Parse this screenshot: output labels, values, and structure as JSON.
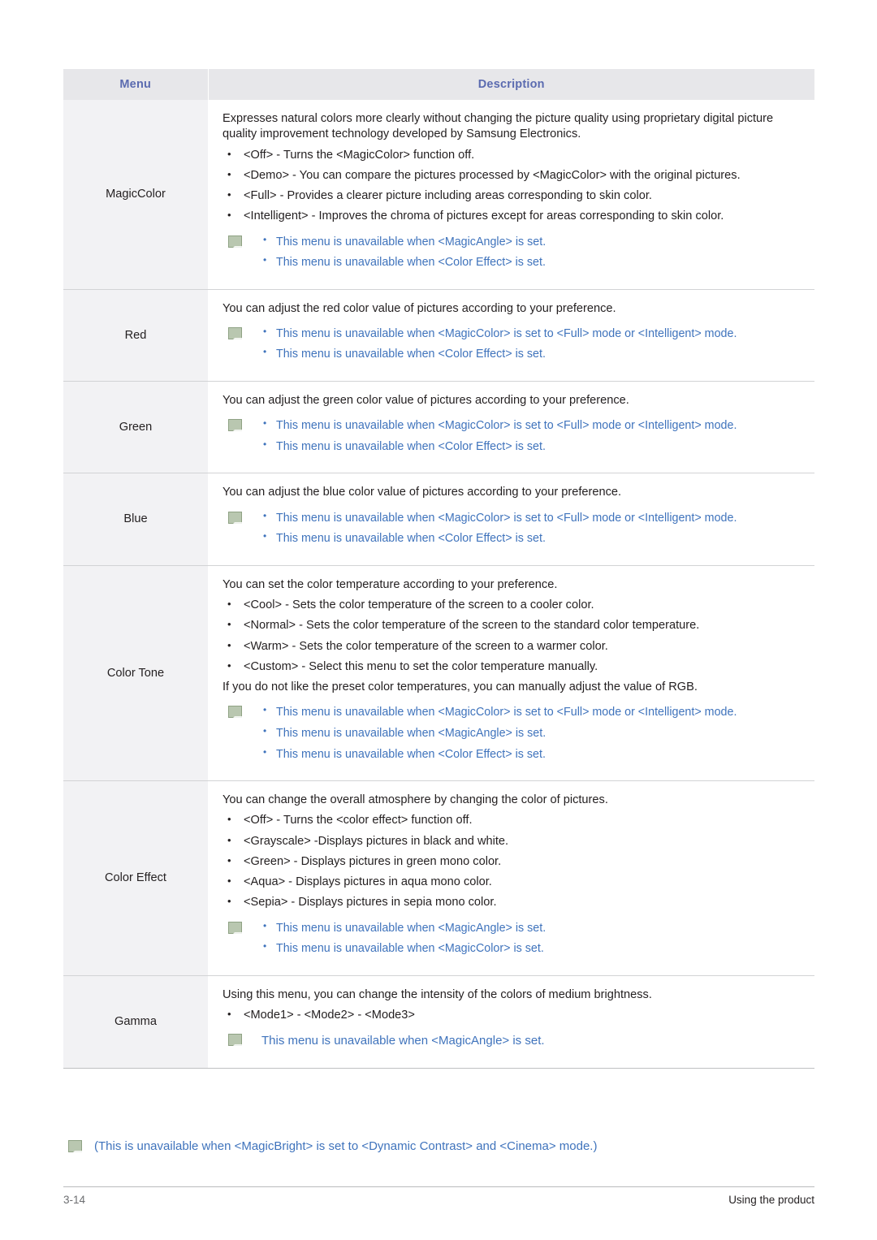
{
  "table": {
    "headers": {
      "menu": "Menu",
      "description": "Description"
    },
    "rows": [
      {
        "menu": "MagicColor",
        "intro": [
          "Expresses natural colors more clearly without changing the picture quality using proprietary digital picture quality improvement technology developed by Samsung Electronics."
        ],
        "bullets": [
          "<Off> - Turns the <MagicColor> function off.",
          "<Demo> - You can compare the pictures processed by <MagicColor> with the original pictures.",
          "<Full> - Provides a clearer picture including areas corresponding to skin color.",
          "<Intelligent> - Improves the chroma of pictures except for areas corresponding to skin color."
        ],
        "notes": [
          "This menu is unavailable when <MagicAngle> is set.",
          "This menu is unavailable when <Color Effect> is set."
        ],
        "note_style": "list"
      },
      {
        "menu": "Red",
        "intro": [
          "You can adjust the red color value of pictures according to your preference."
        ],
        "bullets": [],
        "notes": [
          "This menu is unavailable when <MagicColor> is set to <Full> mode or <Intelligent> mode.",
          "This menu is unavailable when <Color Effect> is set."
        ],
        "note_style": "list"
      },
      {
        "menu": "Green",
        "intro": [
          "You can adjust the green color value of pictures according to your preference."
        ],
        "bullets": [],
        "notes": [
          "This menu is unavailable when <MagicColor> is set to <Full> mode or <Intelligent> mode.",
          "This menu is unavailable when <Color Effect> is set."
        ],
        "note_style": "list"
      },
      {
        "menu": "Blue",
        "intro": [
          "You can adjust the blue color value of pictures according to your preference."
        ],
        "bullets": [],
        "notes": [
          "This menu is unavailable when <MagicColor> is set to <Full> mode or <Intelligent> mode.",
          "This menu is unavailable when <Color Effect> is set."
        ],
        "note_style": "list"
      },
      {
        "menu": "Color Tone",
        "intro": [
          "You can set the color temperature according to your preference."
        ],
        "bullets": [
          "<Cool> - Sets the color temperature of the screen to a cooler color.",
          "<Normal> - Sets the color temperature of the screen to the standard color temperature.",
          "<Warm> - Sets the color temperature of the screen to a warmer color.",
          "<Custom> - Select this menu to set the color temperature manually."
        ],
        "after": [
          "If you do not like the preset color temperatures, you can manually adjust the value of RGB."
        ],
        "notes": [
          "This menu is unavailable when <MagicColor> is set to <Full> mode or <Intelligent> mode.",
          "This menu is unavailable when <MagicAngle> is set.",
          "This menu is unavailable when <Color Effect> is set."
        ],
        "note_style": "list"
      },
      {
        "menu": "Color Effect",
        "intro": [
          "You can change the overall atmosphere by changing the color of pictures."
        ],
        "bullets": [
          "<Off> - Turns the <color effect> function off.",
          "<Grayscale> -Displays pictures in black and white.",
          "<Green> - Displays pictures in green mono color.",
          "<Aqua> - Displays pictures in aqua mono color.",
          "<Sepia> - Displays pictures in sepia mono color."
        ],
        "notes": [
          "This menu is unavailable when <MagicAngle> is set.",
          "This menu is unavailable when <MagicColor> is set."
        ],
        "note_style": "list"
      },
      {
        "menu": "Gamma",
        "intro": [
          "Using this menu, you can change the intensity of the colors of medium brightness."
        ],
        "bullets": [
          "<Mode1> - <Mode2> - <Mode3>"
        ],
        "notes": [
          "This menu is unavailable when <MagicAngle> is set."
        ],
        "note_style": "single"
      }
    ]
  },
  "footnote": "(This is unavailable when <MagicBright> is set to <Dynamic Contrast> and <Cinema> mode.)",
  "footer": {
    "page_number": "3-14",
    "section": "Using the product"
  },
  "colors": {
    "note_blue": "#3f73bc",
    "header_text": "#5b6bb0",
    "header_bg": "#e7e7ea",
    "menu_bg": "#f2f2f4"
  }
}
